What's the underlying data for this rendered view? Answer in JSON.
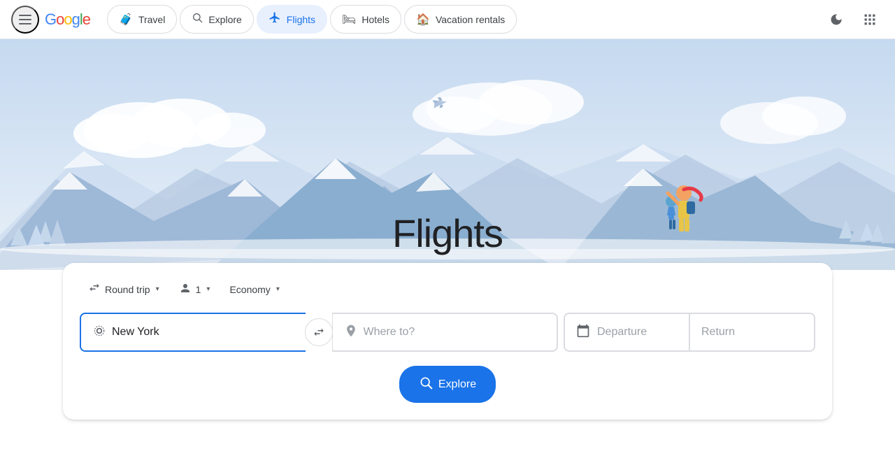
{
  "header": {
    "menu_icon": "☰",
    "logo_letters": [
      "G",
      "o",
      "o",
      "g",
      "l",
      "e"
    ],
    "nav_items": [
      {
        "label": "Travel",
        "icon": "🧳",
        "active": false
      },
      {
        "label": "Explore",
        "icon": "🔍",
        "active": false
      },
      {
        "label": "Flights",
        "icon": "✈",
        "active": true
      },
      {
        "label": "Hotels",
        "icon": "🛏",
        "active": false
      },
      {
        "label": "Vacation rentals",
        "icon": "🏠",
        "active": false
      }
    ],
    "dark_mode_icon": "🌙",
    "apps_icon": "⋮⋮⋮"
  },
  "hero": {
    "title": "Flights",
    "plane_icon": "✈"
  },
  "search": {
    "trip_type_label": "Round trip",
    "trip_type_icon": "⇄",
    "passengers_label": "1",
    "passengers_icon": "👤",
    "class_label": "Economy",
    "origin_placeholder": "New York",
    "origin_icon": "◎",
    "destination_placeholder": "Where to?",
    "destination_icon": "📍",
    "swap_icon": "⇄",
    "departure_placeholder": "Departure",
    "return_placeholder": "Return",
    "calendar_icon": "📅",
    "explore_label": "Explore",
    "explore_icon": "🔍",
    "chevron": "▾"
  }
}
